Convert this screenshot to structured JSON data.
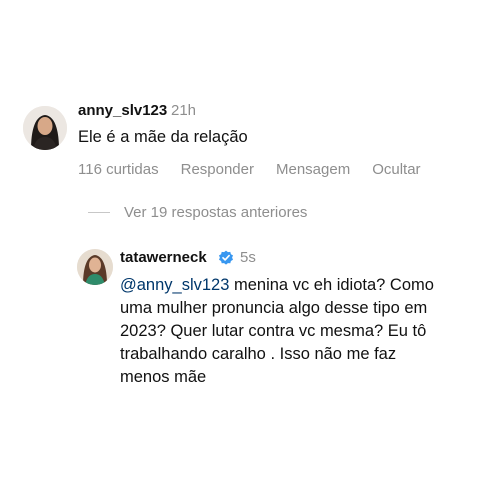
{
  "comment": {
    "username": "anny_slv123",
    "time": "21h",
    "text": "Ele é a mãe da relação",
    "actions": {
      "likes": "116 curtidas",
      "reply": "Responder",
      "message": "Mensagem",
      "hide": "Ocultar"
    }
  },
  "view_replies": "Ver 19 respostas anteriores",
  "reply": {
    "username": "tatawerneck",
    "time": "5s",
    "mention": "@anny_slv123",
    "text": " menina vc eh idiota? Como uma mulher pronuncia algo desse tipo em 2023? Quer lutar contra vc mesma? Eu tô trabalhando caralho . Isso não me faz menos mãe"
  },
  "colors": {
    "secondary_text": "#8e8e8e",
    "mention": "#00376b",
    "verified_badge": "#3897f0"
  }
}
